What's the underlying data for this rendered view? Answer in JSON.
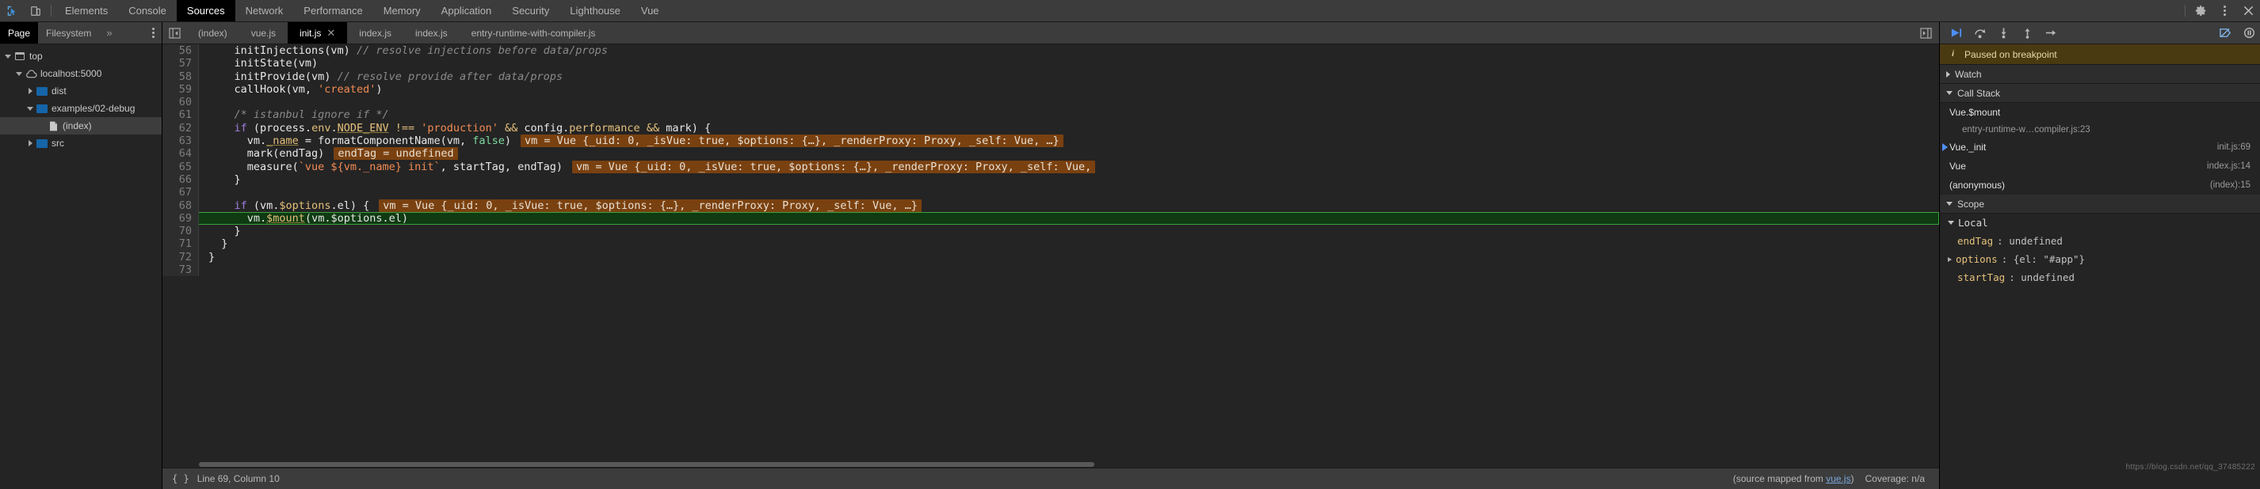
{
  "toolbar": {
    "icons": [
      {
        "name": "inspect-element-icon",
        "label": "inspect"
      },
      {
        "name": "device-toolbar-icon",
        "label": "device-toggle"
      }
    ],
    "panels": [
      {
        "label": "Elements",
        "active": false
      },
      {
        "label": "Console",
        "active": false
      },
      {
        "label": "Sources",
        "active": true
      },
      {
        "label": "Network",
        "active": false
      },
      {
        "label": "Performance",
        "active": false
      },
      {
        "label": "Memory",
        "active": false
      },
      {
        "label": "Application",
        "active": false
      },
      {
        "label": "Security",
        "active": false
      },
      {
        "label": "Lighthouse",
        "active": false
      },
      {
        "label": "Vue",
        "active": false
      }
    ],
    "right_icons": [
      {
        "name": "gear-icon"
      },
      {
        "name": "kebab-menu-icon"
      },
      {
        "name": "close-icon"
      }
    ]
  },
  "navigator": {
    "tabs": [
      {
        "label": "Page",
        "active": true
      },
      {
        "label": "Filesystem",
        "active": false
      }
    ],
    "overflow_label": "»",
    "tree": [
      {
        "label": "top",
        "icon": "frame-icon",
        "indent": 0,
        "twisty": "down",
        "selected": false
      },
      {
        "label": "localhost:5000",
        "icon": "cloud-icon",
        "indent": 1,
        "twisty": "down",
        "selected": false
      },
      {
        "label": "dist",
        "icon": "folder-icon",
        "indent": 2,
        "twisty": "right",
        "selected": false
      },
      {
        "label": "examples/02-debug",
        "icon": "folder-icon",
        "indent": 2,
        "twisty": "down",
        "selected": false
      },
      {
        "label": "(index)",
        "icon": "file-icon",
        "indent": 3,
        "twisty": "none",
        "selected": true
      },
      {
        "label": "src",
        "icon": "folder-icon",
        "indent": 2,
        "twisty": "right",
        "selected": false
      }
    ]
  },
  "editor": {
    "tabs": [
      {
        "label": "(index)",
        "active": false,
        "closable": false
      },
      {
        "label": "vue.js",
        "active": false,
        "closable": false
      },
      {
        "label": "init.js",
        "active": true,
        "closable": true
      },
      {
        "label": "index.js",
        "active": false,
        "closable": false
      },
      {
        "label": "index.js",
        "active": false,
        "closable": false
      },
      {
        "label": "entry-runtime-with-compiler.js",
        "active": false,
        "closable": false
      }
    ],
    "lines": [
      {
        "n": "56",
        "highlight": false,
        "tokens": [
          {
            "t": "    ",
            "c": "plain"
          },
          {
            "t": "initInjections(vm) ",
            "c": "plain"
          },
          {
            "t": "// resolve injections before data/props",
            "c": "cmt"
          }
        ]
      },
      {
        "n": "57",
        "highlight": false,
        "tokens": [
          {
            "t": "    initState(vm)",
            "c": "plain"
          }
        ]
      },
      {
        "n": "58",
        "highlight": false,
        "tokens": [
          {
            "t": "    initProvide(vm) ",
            "c": "plain"
          },
          {
            "t": "// resolve provide after data/props",
            "c": "cmt"
          }
        ]
      },
      {
        "n": "59",
        "highlight": false,
        "tokens": [
          {
            "t": "    callHook(vm, ",
            "c": "plain"
          },
          {
            "t": "'created'",
            "c": "str"
          },
          {
            "t": ")",
            "c": "plain"
          }
        ]
      },
      {
        "n": "60",
        "highlight": false,
        "tokens": []
      },
      {
        "n": "61",
        "highlight": false,
        "tokens": [
          {
            "t": "    ",
            "c": "plain"
          },
          {
            "t": "/* istanbul ignore if */",
            "c": "cmt"
          }
        ]
      },
      {
        "n": "62",
        "highlight": false,
        "tokens": [
          {
            "t": "    ",
            "c": "plain"
          },
          {
            "t": "if",
            "c": "kw"
          },
          {
            "t": " (process.",
            "c": "plain"
          },
          {
            "t": "env",
            "c": "prop"
          },
          {
            "t": ".",
            "c": "plain"
          },
          {
            "t": "NODE_ENV",
            "c": "prop-under"
          },
          {
            "t": " ",
            "c": "plain"
          },
          {
            "t": "!==",
            "c": "op"
          },
          {
            "t": " ",
            "c": "plain"
          },
          {
            "t": "'production'",
            "c": "str"
          },
          {
            "t": " ",
            "c": "plain"
          },
          {
            "t": "&&",
            "c": "op"
          },
          {
            "t": " config.",
            "c": "plain"
          },
          {
            "t": "performance",
            "c": "prop"
          },
          {
            "t": " ",
            "c": "plain"
          },
          {
            "t": "&&",
            "c": "op"
          },
          {
            "t": " mark) {",
            "c": "plain"
          }
        ]
      },
      {
        "n": "63",
        "highlight": false,
        "tokens": [
          {
            "t": "      vm.",
            "c": "plain"
          },
          {
            "t": "_name",
            "c": "prop-under"
          },
          {
            "t": " = formatComponentName(vm, ",
            "c": "plain"
          },
          {
            "t": "false",
            "c": "bool"
          },
          {
            "t": ")",
            "c": "plain"
          }
        ],
        "inline": "vm = Vue {_uid: 0, _isVue: true, $options: {…}, _renderProxy: Proxy, _self: Vue, …}"
      },
      {
        "n": "64",
        "highlight": false,
        "tokens": [
          {
            "t": "      mark(endTag)",
            "c": "plain"
          }
        ],
        "inline": "endTag = undefined"
      },
      {
        "n": "65",
        "highlight": false,
        "tokens": [
          {
            "t": "      measure(",
            "c": "plain"
          },
          {
            "t": "`vue ${vm._name} init`",
            "c": "str"
          },
          {
            "t": ", startTag, endTag)",
            "c": "plain"
          }
        ],
        "inline": "vm = Vue {_uid: 0, _isVue: true, $options: {…}, _renderProxy: Proxy, _self: Vue,"
      },
      {
        "n": "66",
        "highlight": false,
        "tokens": [
          {
            "t": "    }",
            "c": "plain"
          }
        ]
      },
      {
        "n": "67",
        "highlight": false,
        "tokens": []
      },
      {
        "n": "68",
        "highlight": false,
        "tokens": [
          {
            "t": "    ",
            "c": "plain"
          },
          {
            "t": "if",
            "c": "kw"
          },
          {
            "t": " (vm.",
            "c": "plain"
          },
          {
            "t": "$options",
            "c": "prop"
          },
          {
            "t": ".el) {",
            "c": "plain"
          }
        ],
        "inline": "vm = Vue {_uid: 0, _isVue: true, $options: {…}, _renderProxy: Proxy, _self: Vue, …}"
      },
      {
        "n": "69",
        "highlight": true,
        "tokens": [
          {
            "t": "      vm.",
            "c": "plain"
          },
          {
            "t": "$mount",
            "c": "prop-under"
          },
          {
            "t": "(vm.$options.el)",
            "c": "plain"
          }
        ]
      },
      {
        "n": "70",
        "highlight": false,
        "tokens": [
          {
            "t": "    }",
            "c": "plain"
          }
        ]
      },
      {
        "n": "71",
        "highlight": false,
        "tokens": [
          {
            "t": "  }",
            "c": "plain"
          }
        ]
      },
      {
        "n": "72",
        "highlight": false,
        "tokens": [
          {
            "t": "}",
            "c": "plain"
          }
        ]
      },
      {
        "n": "73",
        "highlight": false,
        "tokens": []
      }
    ]
  },
  "statusbar": {
    "braces_icon": "{ }",
    "position": "Line 69, Column 10",
    "source_map_prefix": "(source mapped from ",
    "source_map_link": "vue.js",
    "source_map_suffix": ")",
    "coverage": "Coverage: n/a"
  },
  "debugger": {
    "controls": [
      {
        "name": "resume-script-execution-button",
        "glyph": "resume"
      },
      {
        "name": "step-over-next-function-call-button",
        "glyph": "step-over"
      },
      {
        "name": "step-into-next-function-call-button",
        "glyph": "step-into"
      },
      {
        "name": "step-out-of-current-function-button",
        "glyph": "step-out"
      },
      {
        "name": "step-button",
        "glyph": "step"
      },
      {
        "name": "deactivate-breakpoints-button",
        "glyph": "deactivate"
      },
      {
        "name": "pause-on-exceptions-button",
        "glyph": "pause-exceptions"
      }
    ],
    "paused_banner": "Paused on breakpoint",
    "sections": [
      {
        "title": "Watch",
        "expanded": false
      },
      {
        "title": "Call Stack",
        "expanded": true
      },
      {
        "title": "Scope",
        "expanded": true
      }
    ],
    "call_stack": [
      {
        "name": "Vue.$mount",
        "location": "",
        "sub": "entry-runtime-w…compiler.js:23",
        "current": false
      },
      {
        "name": "Vue._init",
        "location": "init.js:69",
        "sub": "",
        "current": true
      },
      {
        "name": "Vue",
        "location": "index.js:14",
        "sub": "",
        "current": false
      },
      {
        "name": "(anonymous)",
        "location": "(index):15",
        "sub": "",
        "current": false
      }
    ],
    "scope": {
      "title": "Local",
      "vars": [
        {
          "key": "endTag",
          "value": ": undefined",
          "expandable": false
        },
        {
          "key": "options",
          "value": ": {el: \"#app\"}",
          "expandable": true
        },
        {
          "key": "startTag",
          "value": ": undefined",
          "expandable": false
        }
      ]
    }
  },
  "watermark": "https://blog.csdn.net/qq_37485222"
}
